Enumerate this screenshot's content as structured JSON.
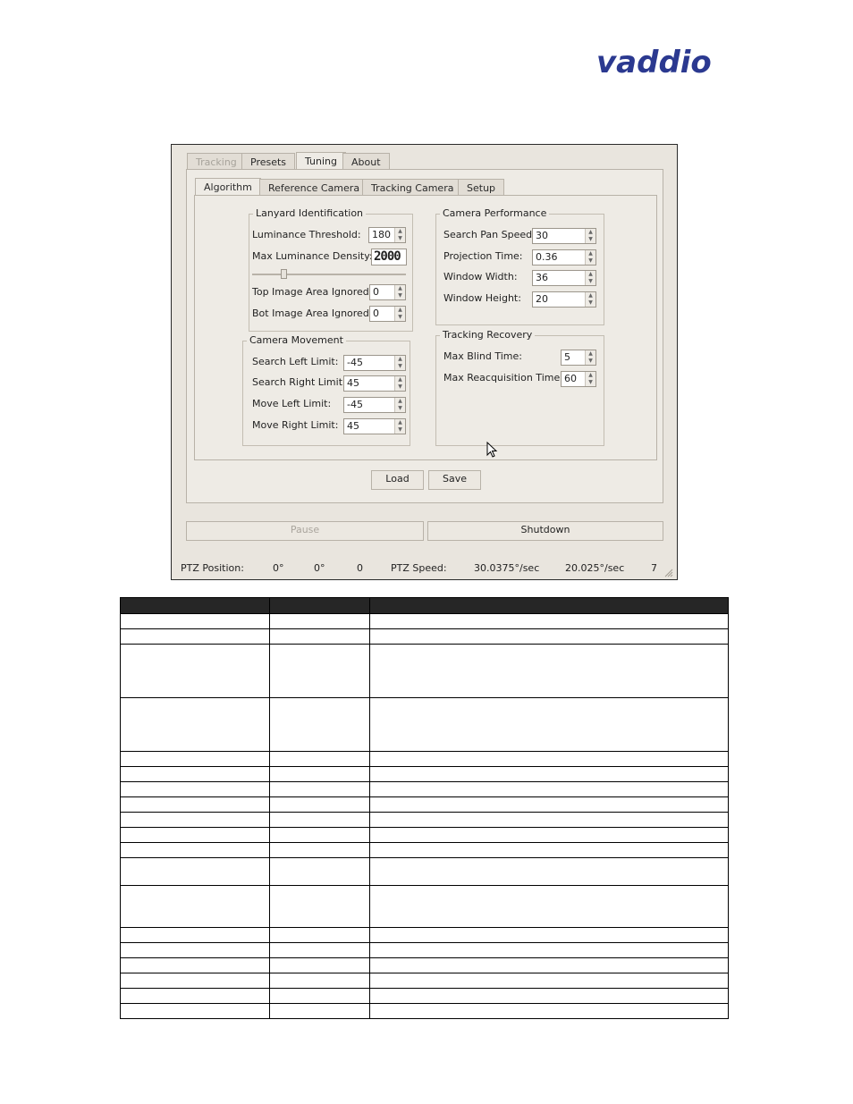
{
  "logo": {
    "text": "vaddio",
    "color": "#2b3990"
  },
  "window": {
    "main_tabs": [
      {
        "label": "Tracking",
        "state": "disabled"
      },
      {
        "label": "Presets",
        "state": "normal"
      },
      {
        "label": "Tuning",
        "state": "active"
      },
      {
        "label": "About",
        "state": "normal"
      }
    ],
    "sub_tabs": [
      {
        "label": "Algorithm",
        "state": "active"
      },
      {
        "label": "Reference Camera",
        "state": "normal"
      },
      {
        "label": "Tracking Camera",
        "state": "normal"
      },
      {
        "label": "Setup",
        "state": "normal"
      }
    ],
    "lanyard": {
      "title": "Lanyard Identification",
      "luminance_threshold_label": "Luminance Threshold:",
      "luminance_threshold_value": "180",
      "max_luminance_density_label": "Max Luminance Density:",
      "max_luminance_density_value": "2000",
      "top_ignored_label": "Top Image Area Ignored:",
      "top_ignored_value": "0",
      "bot_ignored_label": "Bot Image Area Ignored:",
      "bot_ignored_value": "0"
    },
    "camera_performance": {
      "title": "Camera Performance",
      "search_pan_speed_label": "Search Pan Speed:",
      "search_pan_speed_value": "30",
      "projection_time_label": "Projection Time:",
      "projection_time_value": "0.36",
      "window_width_label": "Window Width:",
      "window_width_value": "36",
      "window_height_label": "Window Height:",
      "window_height_value": "20"
    },
    "camera_movement": {
      "title": "Camera Movement",
      "search_left_label": "Search Left Limit:",
      "search_left_value": "-45",
      "search_right_label": "Search Right Limit:",
      "search_right_value": "45",
      "move_left_label": "Move Left Limit:",
      "move_left_value": "-45",
      "move_right_label": "Move Right Limit:",
      "move_right_value": "45"
    },
    "tracking_recovery": {
      "title": "Tracking Recovery",
      "max_blind_label": "Max Blind Time:",
      "max_blind_value": "5",
      "max_reacq_label": "Max Reacquisition Time:",
      "max_reacq_value": "60"
    },
    "buttons": {
      "load": "Load",
      "save": "Save",
      "pause": "Pause",
      "shutdown": "Shutdown"
    },
    "status": {
      "ptz_position_label": "PTZ Position:",
      "pos_pan": "0°",
      "pos_tilt": "0°",
      "pos_zoom": "0",
      "ptz_speed_label": "PTZ Speed:",
      "speed_pan": "30.0375°/sec",
      "speed_tilt": "20.025°/sec",
      "speed_zoom": "7"
    }
  }
}
